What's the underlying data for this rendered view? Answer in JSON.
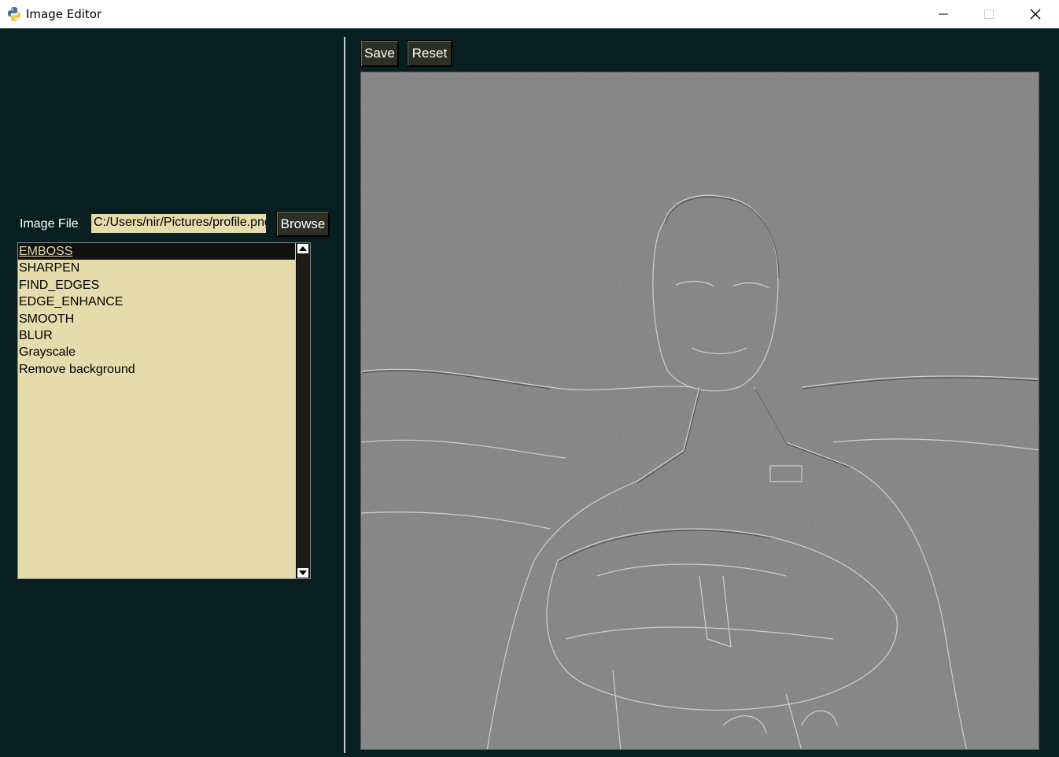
{
  "window": {
    "title": "Image Editor"
  },
  "file": {
    "label": "Image File",
    "path": "C:/Users/nir/Pictures/profile.png",
    "browse_label": "Browse"
  },
  "filters": {
    "items": [
      "EMBOSS",
      "SHARPEN",
      "FIND_EDGES",
      "EDGE_ENHANCE",
      "SMOOTH",
      "BLUR",
      "Grayscale",
      "Remove background"
    ],
    "selected": "EMBOSS"
  },
  "toolbar": {
    "save_label": "Save",
    "reset_label": "Reset"
  },
  "colors": {
    "background": "#081f22",
    "list_bg": "#e5dbab",
    "button_bg": "#2b2f24",
    "emboss_gray": "#7f7f7f"
  },
  "icons": {
    "app": "python-icon",
    "minimize": "minimize-icon",
    "maximize": "maximize-icon",
    "close": "close-icon"
  }
}
